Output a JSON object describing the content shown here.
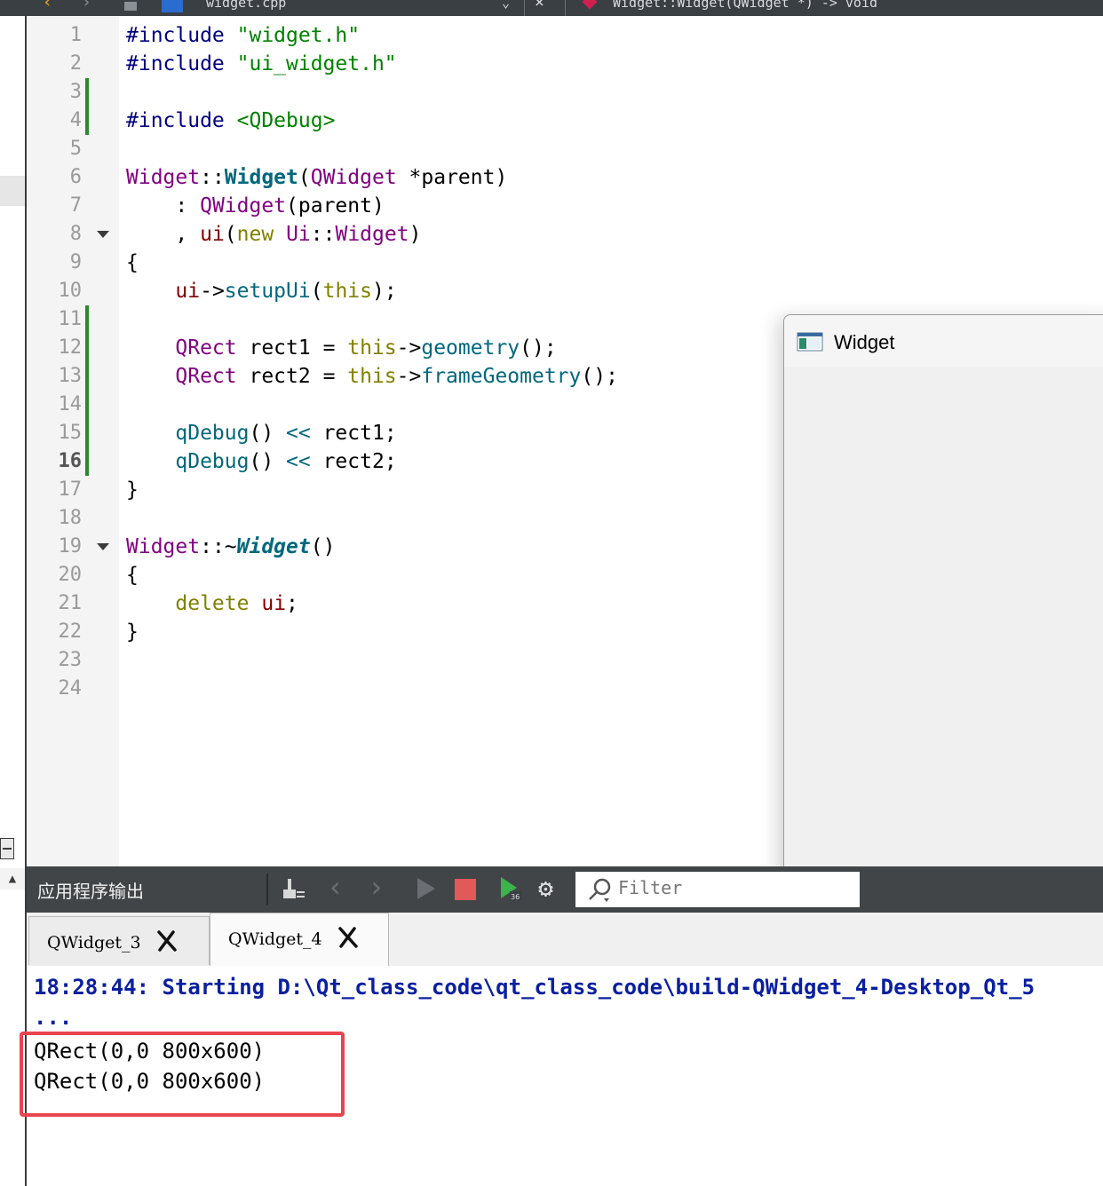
{
  "topbar": {
    "file_name": "widget.cpp",
    "symbol": "Widget::Widget(QWidget *) -> void"
  },
  "editor": {
    "line_numbers": [
      "1",
      "2",
      "3",
      "4",
      "5",
      "6",
      "7",
      "8",
      "9",
      "10",
      "11",
      "12",
      "13",
      "14",
      "15",
      "16",
      "17",
      "18",
      "19",
      "20",
      "21",
      "22",
      "23",
      "24"
    ],
    "current_line": 16,
    "modified_lines": [
      3,
      4,
      11,
      12,
      13,
      14,
      15,
      16
    ],
    "fold_lines": [
      8,
      19
    ],
    "code": {
      "l1a": "#include",
      "l1b": "\"widget.h\"",
      "l2a": "#include",
      "l2b": "\"ui_widget.h\"",
      "l4a": "#include",
      "l4b": "<QDebug>",
      "l6a": "Widget",
      "l6b": "::",
      "l6c": "Widget",
      "l6d": "(",
      "l6e": "QWidget",
      "l6f": " *parent)",
      "l7a": "    : ",
      "l7b": "QWidget",
      "l7c": "(parent)",
      "l8a": "    , ",
      "l8b": "ui",
      "l8c": "(",
      "l8d": "new",
      "l8e": " ",
      "l8f": "Ui",
      "l8g": "::",
      "l8h": "Widget",
      "l8i": ")",
      "l9": "{",
      "l10a": "    ",
      "l10b": "ui",
      "l10c": "->",
      "l10d": "setupUi",
      "l10e": "(",
      "l10f": "this",
      "l10g": ");",
      "l12a": "    ",
      "l12b": "QRect",
      "l12c": " rect1 = ",
      "l12d": "this",
      "l12e": "->",
      "l12f": "geometry",
      "l12g": "();",
      "l13a": "    ",
      "l13b": "QRect",
      "l13c": " rect2 = ",
      "l13d": "this",
      "l13e": "->",
      "l13f": "frameGeometry",
      "l13g": "();",
      "l15a": "    ",
      "l15b": "qDebug",
      "l15c": "() ",
      "l15d": "<<",
      "l15e": " rect1;",
      "l16a": "    ",
      "l16b": "qDebug",
      "l16c": "() ",
      "l16d": "<<",
      "l16e": " rect2;",
      "l17": "}",
      "l19a": "Widget",
      "l19b": "::~",
      "l19c": "Widget",
      "l19d": "()",
      "l20": "{",
      "l21a": "    ",
      "l21b": "delete",
      "l21c": " ",
      "l21d": "ui",
      "l21e": ";",
      "l22": "}"
    }
  },
  "widget_window": {
    "title": "Widget"
  },
  "output": {
    "title": "应用程序输出",
    "filter_placeholder": "Filter",
    "tabs": [
      {
        "label": "QWidget_3"
      },
      {
        "label": "QWidget_4"
      }
    ],
    "active_tab": 1,
    "start_line": "18:28:44: Starting D:\\Qt_class_code\\qt_class_code\\build-QWidget_4-Desktop_Qt_5",
    "ellipsis": "...",
    "results": [
      "QRect(0,0 800x600)",
      "QRect(0,0 800x600)"
    ],
    "highlight_color": "#e8454f"
  }
}
